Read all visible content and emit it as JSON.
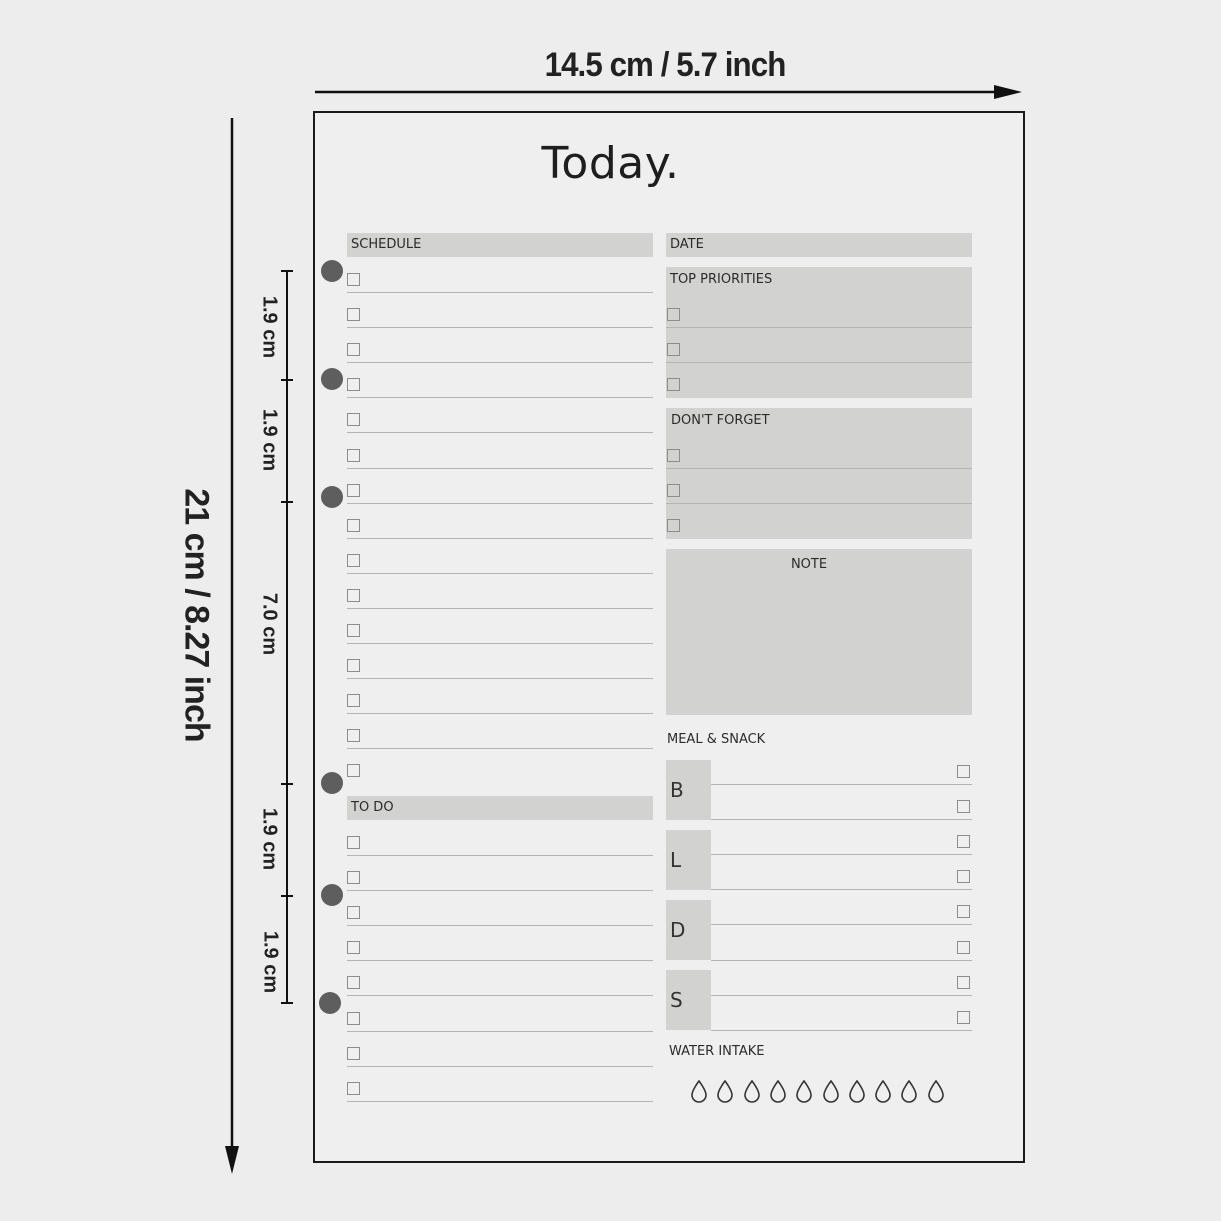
{
  "dimensions": {
    "width_label": "14.5 cm / 5.7 inch",
    "height_label": "21 cm / 8.27 inch",
    "segments": [
      "1.9 cm",
      "1.9 cm",
      "7.0 cm",
      "1.9 cm",
      "1.9 cm"
    ]
  },
  "page": {
    "title": "Today.",
    "schedule_label": "SCHEDULE",
    "todo_label": "TO DO",
    "date_label": "DATE",
    "top_priorities_label": "TOP PRIORITIES",
    "dont_forget_label": "DON'T FORGET",
    "note_label": "NOTE",
    "meal_label": "MEAL & SNACK",
    "meals": [
      "B",
      "L",
      "D",
      "S"
    ],
    "water_label": "WATER INTAKE",
    "water_drops": 10
  },
  "colors": {
    "shade": "#d2d2d0",
    "hole": "#5e5e5e",
    "background": "#ededed"
  }
}
